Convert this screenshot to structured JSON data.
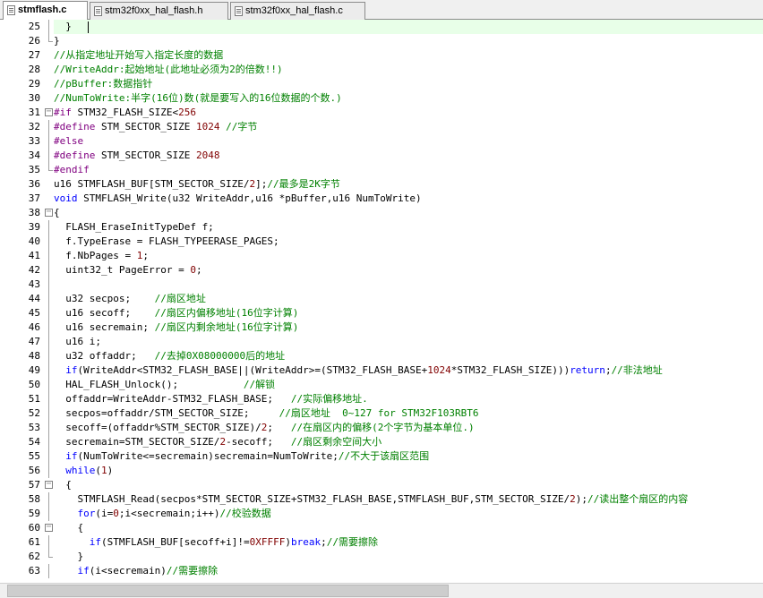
{
  "tabs": [
    {
      "label": "stmflash.c",
      "active": true
    },
    {
      "label": "stm32f0xx_hal_flash.h",
      "active": false
    },
    {
      "label": "stm32f0xx_hal_flash.c",
      "active": false
    }
  ],
  "lines": [
    {
      "n": "25",
      "text": "  }"
    },
    {
      "n": "26",
      "text": "}"
    },
    {
      "n": "27",
      "text": "//从指定地址开始写入指定长度的数据"
    },
    {
      "n": "28",
      "text": "//WriteAddr:起始地址(此地址必须为2的倍数!!)"
    },
    {
      "n": "29",
      "text": "//pBuffer:数据指针"
    },
    {
      "n": "30",
      "text": "//NumToWrite:半字(16位)数(就是要写入的16位数据的个数.)"
    },
    {
      "n": "31",
      "text": "#if STM32_FLASH_SIZE<256"
    },
    {
      "n": "32",
      "text": "#define STM_SECTOR_SIZE 1024 //字节"
    },
    {
      "n": "33",
      "text": "#else"
    },
    {
      "n": "34",
      "text": "#define STM_SECTOR_SIZE 2048"
    },
    {
      "n": "35",
      "text": "#endif"
    },
    {
      "n": "36",
      "text": "u16 STMFLASH_BUF[STM_SECTOR_SIZE/2];//最多是2K字节"
    },
    {
      "n": "37",
      "text": "void STMFLASH_Write(u32 WriteAddr,u16 *pBuffer,u16 NumToWrite)"
    },
    {
      "n": "38",
      "text": "{"
    },
    {
      "n": "39",
      "text": "  FLASH_EraseInitTypeDef f;"
    },
    {
      "n": "40",
      "text": "  f.TypeErase = FLASH_TYPEERASE_PAGES;"
    },
    {
      "n": "41",
      "text": "  f.NbPages = 1;"
    },
    {
      "n": "42",
      "text": "  uint32_t PageError = 0;"
    },
    {
      "n": "43",
      "text": ""
    },
    {
      "n": "44",
      "text": "  u32 secpos;    //扇区地址"
    },
    {
      "n": "45",
      "text": "  u16 secoff;    //扇区内偏移地址(16位字计算)"
    },
    {
      "n": "46",
      "text": "  u16 secremain; //扇区内剩余地址(16位字计算)"
    },
    {
      "n": "47",
      "text": "  u16 i;"
    },
    {
      "n": "48",
      "text": "  u32 offaddr;   //去掉0X08000000后的地址"
    },
    {
      "n": "49",
      "text": "  if(WriteAddr<STM32_FLASH_BASE||(WriteAddr>=(STM32_FLASH_BASE+1024*STM32_FLASH_SIZE)))return;//非法地址"
    },
    {
      "n": "50",
      "text": "  HAL_FLASH_Unlock();           //解锁"
    },
    {
      "n": "51",
      "text": "  offaddr=WriteAddr-STM32_FLASH_BASE;   //实际偏移地址."
    },
    {
      "n": "52",
      "text": "  secpos=offaddr/STM_SECTOR_SIZE;     //扇区地址  0~127 for STM32F103RBT6"
    },
    {
      "n": "53",
      "text": "  secoff=(offaddr%STM_SECTOR_SIZE)/2;   //在扇区内的偏移(2个字节为基本单位.)"
    },
    {
      "n": "54",
      "text": "  secremain=STM_SECTOR_SIZE/2-secoff;   //扇区剩余空间大小"
    },
    {
      "n": "55",
      "text": "  if(NumToWrite<=secremain)secremain=NumToWrite;//不大于该扇区范围"
    },
    {
      "n": "56",
      "text": "  while(1)"
    },
    {
      "n": "57",
      "text": "  {"
    },
    {
      "n": "58",
      "text": "    STMFLASH_Read(secpos*STM_SECTOR_SIZE+STM32_FLASH_BASE,STMFLASH_BUF,STM_SECTOR_SIZE/2);//读出整个扇区的内容"
    },
    {
      "n": "59",
      "text": "    for(i=0;i<secremain;i++)//校验数据"
    },
    {
      "n": "60",
      "text": "    {"
    },
    {
      "n": "61",
      "text": "      if(STMFLASH_BUF[secoff+i]!=0XFFFF)break;//需要擦除"
    },
    {
      "n": "62",
      "text": "    }"
    },
    {
      "n": "63",
      "text": "    if(i<secremain)//需要擦除"
    }
  ]
}
